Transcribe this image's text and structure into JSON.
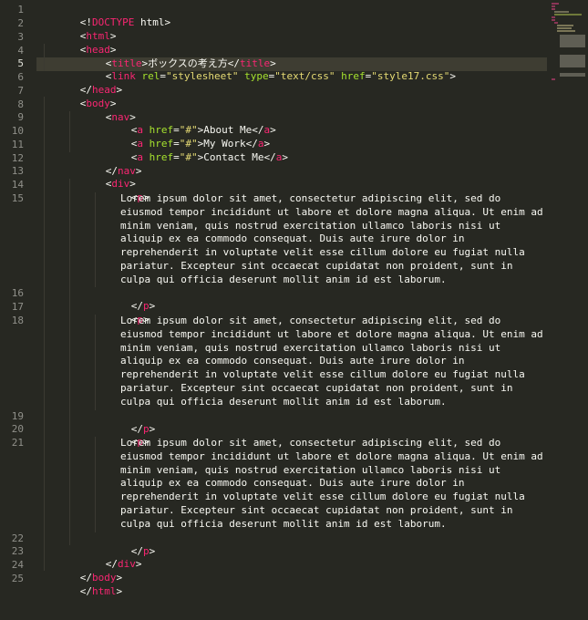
{
  "editor": {
    "theme_colors": {
      "background": "#272822",
      "current_line": "#3e3d32",
      "tag": "#f92672",
      "attribute": "#a6e22e",
      "string": "#e6db74",
      "text": "#f8f8f2",
      "gutter_text": "#90908a"
    },
    "current_line": 5,
    "line_numbers": [
      "1",
      "2",
      "3",
      "4",
      "5",
      "6",
      "7",
      "8",
      "9",
      "10",
      "11",
      "12",
      "13",
      "14",
      "15",
      "16",
      "17",
      "18",
      "19",
      "20",
      "21",
      "22",
      "23",
      "24",
      "25"
    ],
    "lines": {
      "l1": {
        "open": "<!",
        "tag": "DOCTYPE",
        "rest": " html",
        "close": ">"
      },
      "l2": {
        "open": "<",
        "tag": "html",
        "close": ">"
      },
      "l3": {
        "open": "<",
        "tag": "head",
        "close": ">"
      },
      "l4": {
        "open": "<",
        "tag": "title",
        "close": ">",
        "text": "ボックスの考え方",
        "open2": "</",
        "tag2": "title",
        "close2": ">"
      },
      "l5": {
        "open": "<",
        "tag": "link",
        "attr1": " rel",
        "eq1": "=",
        "val1": "\"stylesheet\"",
        "attr2": " type",
        "eq2": "=",
        "val2": "\"text/css\"",
        "attr3": " href",
        "eq3": "=",
        "val3": "\"style17.css\"",
        "close": ">"
      },
      "l6": {
        "open": "</",
        "tag": "head",
        "close": ">"
      },
      "l7": {
        "open": "<",
        "tag": "body",
        "close": ">"
      },
      "l8": {
        "open": "<",
        "tag": "nav",
        "close": ">"
      },
      "l9": {
        "open": "<",
        "tag": "a",
        "attr": " href",
        "eq": "=",
        "val": "\"#\"",
        "close": ">",
        "text": "About Me",
        "open2": "</",
        "tag2": "a",
        "close2": ">"
      },
      "l10": {
        "open": "<",
        "tag": "a",
        "attr": " href",
        "eq": "=",
        "val": "\"#\"",
        "close": ">",
        "text": "My Work",
        "open2": "</",
        "tag2": "a",
        "close2": ">"
      },
      "l11": {
        "open": "<",
        "tag": "a",
        "attr": " href",
        "eq": "=",
        "val": "\"#\"",
        "close": ">",
        "text": "Contact Me",
        "open2": "</",
        "tag2": "a",
        "close2": ">"
      },
      "l12": {
        "open": "</",
        "tag": "nav",
        "close": ">"
      },
      "l13": {
        "open": "<",
        "tag": "div",
        "close": ">"
      },
      "l14": {
        "open": "<",
        "tag": "p",
        "close": ">"
      },
      "l15": {
        "text": "Lorem ipsum dolor sit amet, consectetur adipiscing elit, sed do eiusmod tempor incididunt ut labore et dolore magna aliqua. Ut enim ad minim veniam, quis nostrud exercitation ullamco laboris nisi ut aliquip ex ea commodo consequat. Duis aute irure dolor in reprehenderit in voluptate velit esse cillum dolore eu fugiat nulla pariatur. Excepteur sint occaecat cupidatat non proident, sunt in culpa qui officia deserunt mollit anim id est laborum."
      },
      "l16": {
        "open": "</",
        "tag": "p",
        "close": ">"
      },
      "l17": {
        "open": "<",
        "tag": "p",
        "close": ">"
      },
      "l18": {
        "text": "Lorem ipsum dolor sit amet, consectetur adipiscing elit, sed do eiusmod tempor incididunt ut labore et dolore magna aliqua. Ut enim ad minim veniam, quis nostrud exercitation ullamco laboris nisi ut aliquip ex ea commodo consequat. Duis aute irure dolor in reprehenderit in voluptate velit esse cillum dolore eu fugiat nulla pariatur. Excepteur sint occaecat cupidatat non proident, sunt in culpa qui officia deserunt mollit anim id est laborum."
      },
      "l19": {
        "open": "</",
        "tag": "p",
        "close": ">"
      },
      "l20": {
        "open": "<",
        "tag": "p",
        "close": ">"
      },
      "l21": {
        "text": "Lorem ipsum dolor sit amet, consectetur adipiscing elit, sed do eiusmod tempor incididunt ut labore et dolore magna aliqua. Ut enim ad minim veniam, quis nostrud exercitation ullamco laboris nisi ut aliquip ex ea commodo consequat. Duis aute irure dolor in reprehenderit in voluptate velit esse cillum dolore eu fugiat nulla pariatur. Excepteur sint occaecat cupidatat non proident, sunt in culpa qui officia deserunt mollit anim id est laborum."
      },
      "l22": {
        "open": "</",
        "tag": "p",
        "close": ">"
      },
      "l23": {
        "open": "</",
        "tag": "div",
        "close": ">"
      },
      "l24": {
        "open": "</",
        "tag": "body",
        "close": ">"
      },
      "l25": {
        "open": "</",
        "tag": "html",
        "close": ">"
      }
    }
  }
}
